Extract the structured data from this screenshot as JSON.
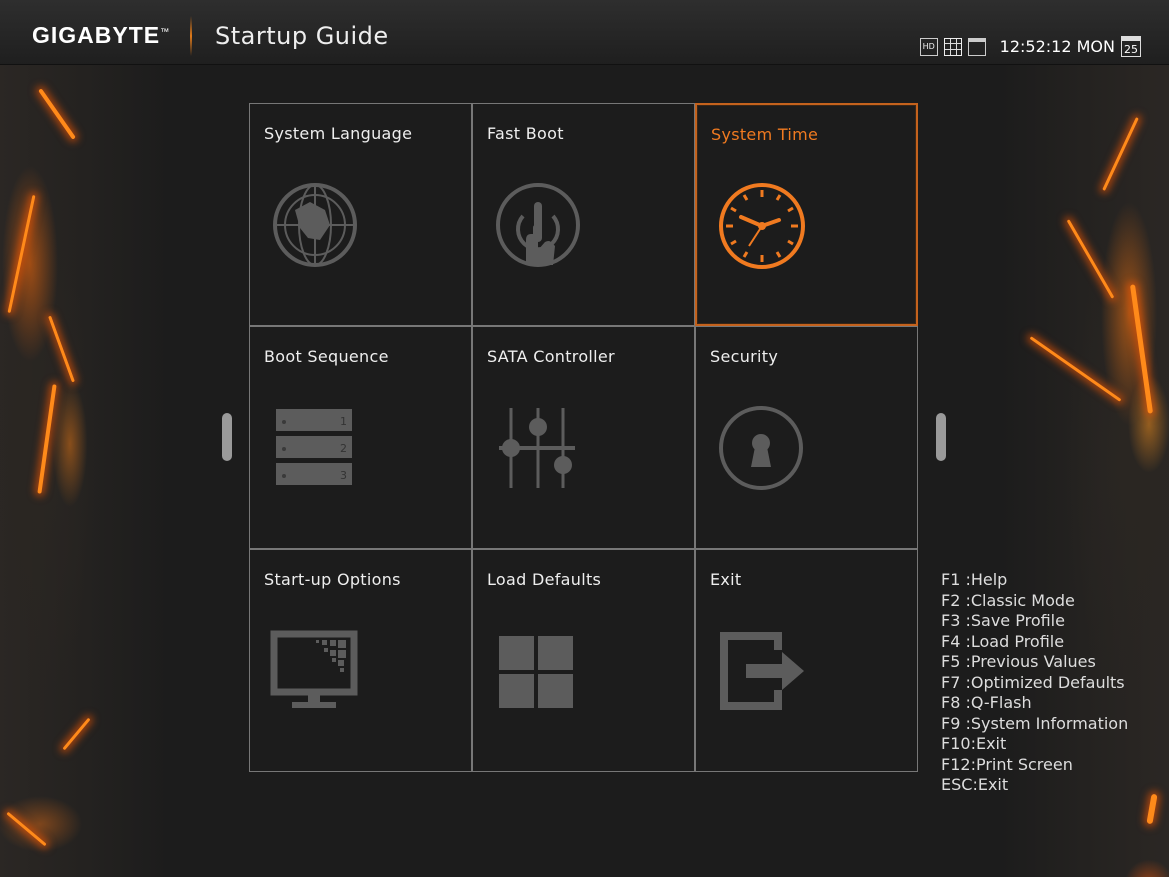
{
  "header": {
    "brand": "GIGABYTE",
    "brand_mark": "™",
    "title": "Startup Guide",
    "icons": [
      "hd-icon",
      "grid-view-icon",
      "window-view-icon"
    ],
    "hd_label": "HD",
    "time": "12:52:12",
    "day": "MON",
    "calendar_date": "25"
  },
  "tiles": [
    {
      "label": "System Language",
      "icon": "globe-icon"
    },
    {
      "label": "Fast Boot",
      "icon": "power-touch-icon"
    },
    {
      "label": "System Time",
      "icon": "clock-icon",
      "selected": true
    },
    {
      "label": "Boot Sequence",
      "icon": "boot-order-icon",
      "order_numbers": [
        "1",
        "2",
        "3"
      ]
    },
    {
      "label": "SATA Controller",
      "icon": "sliders-icon"
    },
    {
      "label": "Security",
      "icon": "keyhole-icon"
    },
    {
      "label": "Start-up Options",
      "icon": "monitor-icon"
    },
    {
      "label": "Load Defaults",
      "icon": "four-squares-icon"
    },
    {
      "label": "Exit",
      "icon": "exit-icon"
    }
  ],
  "hotkeys": [
    "F1 :Help",
    "F2 :Classic Mode",
    "F3 :Save Profile",
    "F4 :Load Profile",
    "F5 :Previous Values",
    "F7 :Optimized Defaults",
    "F8 :Q-Flash",
    "F9 :System Information",
    "F10:Exit",
    "F12:Print Screen",
    "ESC:Exit"
  ],
  "colors": {
    "accent": "#f07a20",
    "tile_border": "#777777",
    "icon_gray": "#5a5a5a"
  }
}
